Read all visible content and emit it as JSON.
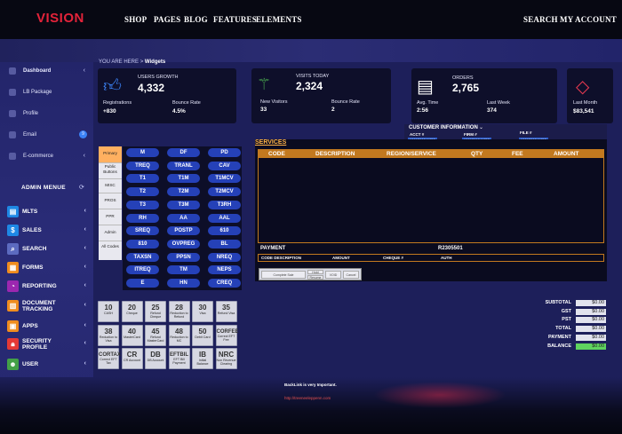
{
  "brand": "VISION",
  "nav": {
    "shop": "SHOP",
    "pages": "PAGES",
    "blog": "BLOG",
    "features": "FEATURES",
    "elements": "ELEMENTS",
    "search": "SEARCH",
    "account": "MY ACCOUNT"
  },
  "breadcrumb": {
    "prefix": "YOU ARE HERE",
    "sep": ">",
    "current": "Widgets"
  },
  "sidebar": {
    "items": [
      {
        "label": "Dashboard",
        "icon": "dashboard-icon"
      },
      {
        "label": "LB Package",
        "icon": "package-icon"
      },
      {
        "label": "Profile",
        "icon": "user-icon"
      },
      {
        "label": "Email",
        "icon": "mail-icon",
        "badge": "9"
      },
      {
        "label": "E-commerce",
        "icon": "cart-icon"
      }
    ],
    "admin_title": "ADMIN MENUE",
    "admin_items": [
      {
        "label": "MLTS",
        "icon": "mlts-icon",
        "color": "#1e88e5"
      },
      {
        "label": "SALES",
        "icon": "sales-icon",
        "color": "#1e88e5"
      },
      {
        "label": "SEARCH",
        "icon": "search-icon",
        "color": "#5c6bc0"
      },
      {
        "label": "FORMS",
        "icon": "forms-icon",
        "color": "#ef8c1e"
      },
      {
        "label": "REPORTING",
        "icon": "reporting-icon",
        "color": "#9c27b0"
      },
      {
        "label": "DOCUMENT TRACKING",
        "icon": "document-icon",
        "color": "#ef8c1e"
      },
      {
        "label": "APPS",
        "icon": "apps-icon",
        "color": "#ef8c1e"
      },
      {
        "label": "SECURITY PROFILE",
        "icon": "lock-icon",
        "color": "#e53935"
      },
      {
        "label": "USER",
        "icon": "user-icon",
        "color": "#43a047"
      }
    ]
  },
  "stats": [
    {
      "icon": "thumbs-up-icon",
      "title": "USERS GROWTH",
      "value": "4,332",
      "l1": "Registrations",
      "v1": "+830",
      "l2": "Bounce Rate",
      "v2": "4.5%"
    },
    {
      "icon": "magic-wand-icon",
      "title": "VISITS TODAY",
      "value": "2,324",
      "l1": "New Visitors",
      "v1": "33",
      "l2": "Bounce Rate",
      "v2": "2"
    },
    {
      "icon": "clipboard-icon",
      "title": "ORDERS",
      "value": "2,765",
      "l1": "Avg. Time",
      "v1": "2:56",
      "l2": "Last Week",
      "v2": "374"
    },
    {
      "icon": "diamond-icon",
      "l1": "Last Month",
      "v1": "$83,541"
    }
  ],
  "customer": {
    "title": "CUSTOMER INFORMATION",
    "acct_label": "ACCT #",
    "acct": "1006780241752",
    "firm_label": "FIRM #",
    "firm": "1006780241752",
    "file_label": "FILE #",
    "file": "1006780241752"
  },
  "services": {
    "title": "SERVICES",
    "cols": [
      "CODE",
      "DESCRIPTION",
      "REGION/SERVICE",
      "QTY",
      "FEE",
      "AMOUNT"
    ],
    "payment_label": "PAYMENT",
    "payment_code": "R2305501",
    "pay_cols": [
      "CODE DESCRIPTION",
      "AMOUNT",
      "CHEQUE #",
      "AUTH"
    ],
    "buttons": [
      "Complete Sale",
      "Hold",
      "Resume",
      "VOID",
      "Cancel"
    ]
  },
  "tabs": [
    "Primary",
    "Public Buttons",
    "MISC",
    "PROS",
    "PPR",
    "Admin",
    "All Codes"
  ],
  "pills": [
    "M",
    "DF",
    "PD",
    "TREQ",
    "TRANL",
    "CAV",
    "T1",
    "T1M",
    "T1MCV",
    "T2",
    "T2M",
    "T2MCV",
    "T3",
    "T3M",
    "T3RH",
    "RH",
    "AA",
    "AAL",
    "SREQ",
    "POSTP",
    "610",
    "810",
    "OVPREG",
    "BL",
    "TAXSN",
    "PPSN",
    "NREQ",
    "ITREQ",
    "TM",
    "NEPS",
    "E",
    "HN",
    "CREQ"
  ],
  "keys": [
    {
      "v": "10",
      "l": "CASH"
    },
    {
      "v": "20",
      "l": "Cheque"
    },
    {
      "v": "25",
      "l": "Refund Cheque"
    },
    {
      "v": "28",
      "l": "Reduction to Refund"
    },
    {
      "v": "30",
      "l": "Visa"
    },
    {
      "v": "35",
      "l": "Refund Visa"
    },
    {
      "v": "38",
      "l": "Reduction to Visa"
    },
    {
      "v": "40",
      "l": "MasterCard"
    },
    {
      "v": "45",
      "l": "Refund MasterCard"
    },
    {
      "v": "48",
      "l": "Reduction to MC"
    },
    {
      "v": "50",
      "l": "Debit Card"
    },
    {
      "v": "CORFEE",
      "l": "Correct EFT Fee"
    },
    {
      "v": "CORTAX",
      "l": "Correct EFT Tax"
    },
    {
      "v": "CR",
      "l": "CR Account"
    },
    {
      "v": "DB",
      "l": "DB Account"
    },
    {
      "v": "EFTBIL",
      "l": "EFT Bill Payment"
    },
    {
      "v": "IB",
      "l": "Initial Balance"
    },
    {
      "v": "NRC",
      "l": "Non Revenue Clearing"
    }
  ],
  "totals": [
    {
      "label": "SUBTOTAL",
      "value": "$0.00"
    },
    {
      "label": "GST",
      "value": "$0.00"
    },
    {
      "label": "PST",
      "value": "$0.00"
    },
    {
      "label": "TOTAL",
      "value": "$0.00"
    },
    {
      "label": "PAYMENT",
      "value": "$0.00"
    },
    {
      "label": "BALANCE",
      "value": "$0.00"
    }
  ],
  "footer": {
    "text": "BackLink is very Important.",
    "url": "http://treeneeleppenn.com"
  }
}
